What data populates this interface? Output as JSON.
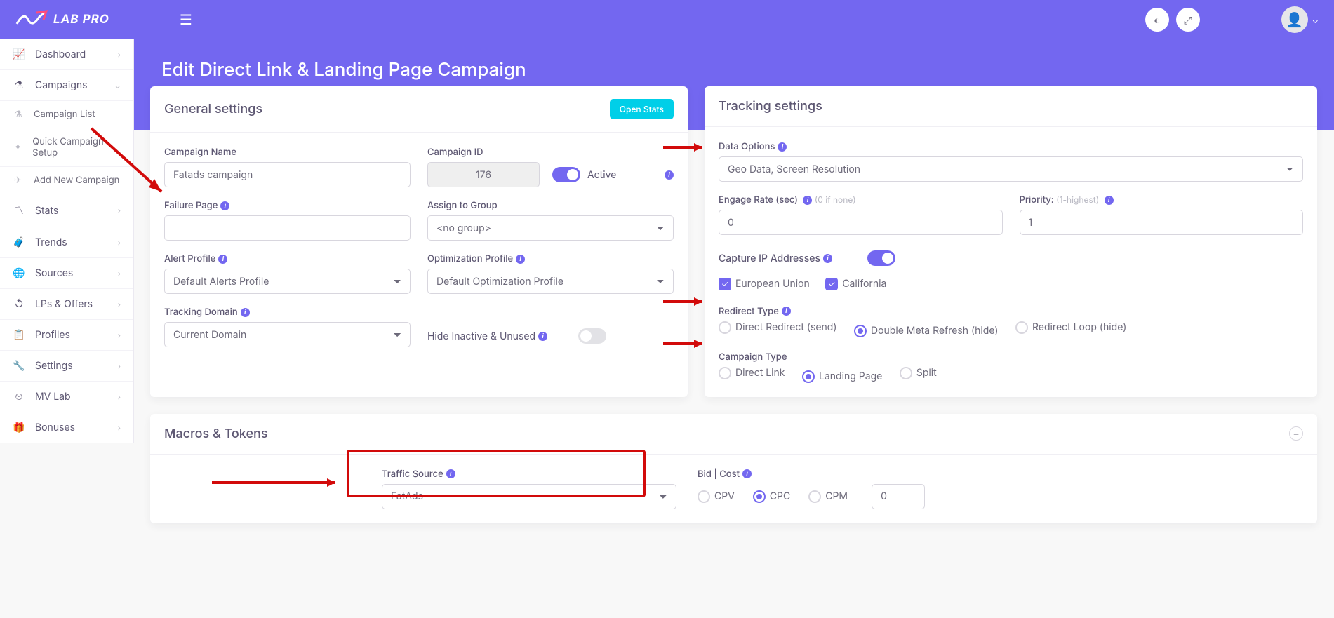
{
  "brand": "LAB PRO",
  "header": {
    "theme_btn": "theme",
    "fullscreen_btn": "fullscreen"
  },
  "page_title": "Edit Direct Link & Landing Page Campaign",
  "sidebar": {
    "items": [
      {
        "icon": "chart",
        "label": "Dashboard",
        "chev": "›"
      },
      {
        "icon": "flask",
        "label": "Campaigns",
        "chev": "⌄",
        "expanded": true,
        "sub": [
          {
            "icon": "flask",
            "label": "Campaign List"
          },
          {
            "icon": "diamond",
            "label": "Quick Campaign Setup"
          },
          {
            "icon": "plane",
            "label": "Add New Campaign"
          }
        ]
      },
      {
        "icon": "zig",
        "label": "Stats",
        "chev": "›"
      },
      {
        "icon": "brief",
        "label": "Trends",
        "chev": "›"
      },
      {
        "icon": "globe",
        "label": "Sources",
        "chev": "›"
      },
      {
        "icon": "history",
        "label": "LPs & Offers",
        "chev": "›"
      },
      {
        "icon": "clip",
        "label": "Profiles",
        "chev": "›"
      },
      {
        "icon": "wrench",
        "label": "Settings",
        "chev": "›"
      },
      {
        "icon": "lab",
        "label": "MV Lab",
        "chev": "›"
      },
      {
        "icon": "gift",
        "label": "Bonuses",
        "chev": "›"
      }
    ]
  },
  "general": {
    "title": "General settings",
    "open_stats": "Open Stats",
    "campaign_name_label": "Campaign Name",
    "campaign_name": "Fatads campaign",
    "campaign_id_label": "Campaign ID",
    "campaign_id": "176",
    "active_label": "Active",
    "failure_page_label": "Failure Page",
    "failure_page": "",
    "assign_group_label": "Assign to Group",
    "assign_group": "<no group>",
    "alert_profile_label": "Alert Profile",
    "alert_profile": "Default Alerts Profile",
    "opt_profile_label": "Optimization Profile",
    "opt_profile": "Default Optimization Profile",
    "tracking_domain_label": "Tracking Domain",
    "tracking_domain": "Current Domain",
    "hide_inactive_label": "Hide Inactive & Unused"
  },
  "tracking": {
    "title": "Tracking settings",
    "data_options_label": "Data Options",
    "data_options": "Geo Data, Screen Resolution",
    "engage_label": "Engage Rate (sec)",
    "engage_hint": "(0 if none)",
    "engage": "0",
    "priority_label": "Priority:",
    "priority_hint": "(1-highest)",
    "priority": "1",
    "capture_ip_label": "Capture IP Addresses",
    "eu_label": "European Union",
    "ca_label": "California",
    "redirect_label": "Redirect Type",
    "redirect_opts": [
      "Direct Redirect (send)",
      "Double Meta Refresh (hide)",
      "Redirect Loop (hide)"
    ],
    "campaign_type_label": "Campaign Type",
    "campaign_type_opts": [
      "Direct Link",
      "Landing Page",
      "Split"
    ]
  },
  "macros": {
    "title": "Macros & Tokens",
    "traffic_source_label": "Traffic Source",
    "traffic_source": "FatAds",
    "bid_label": "Bid | Cost",
    "bid_opts": [
      "CPV",
      "CPC",
      "CPM"
    ],
    "bid_value": "0"
  }
}
